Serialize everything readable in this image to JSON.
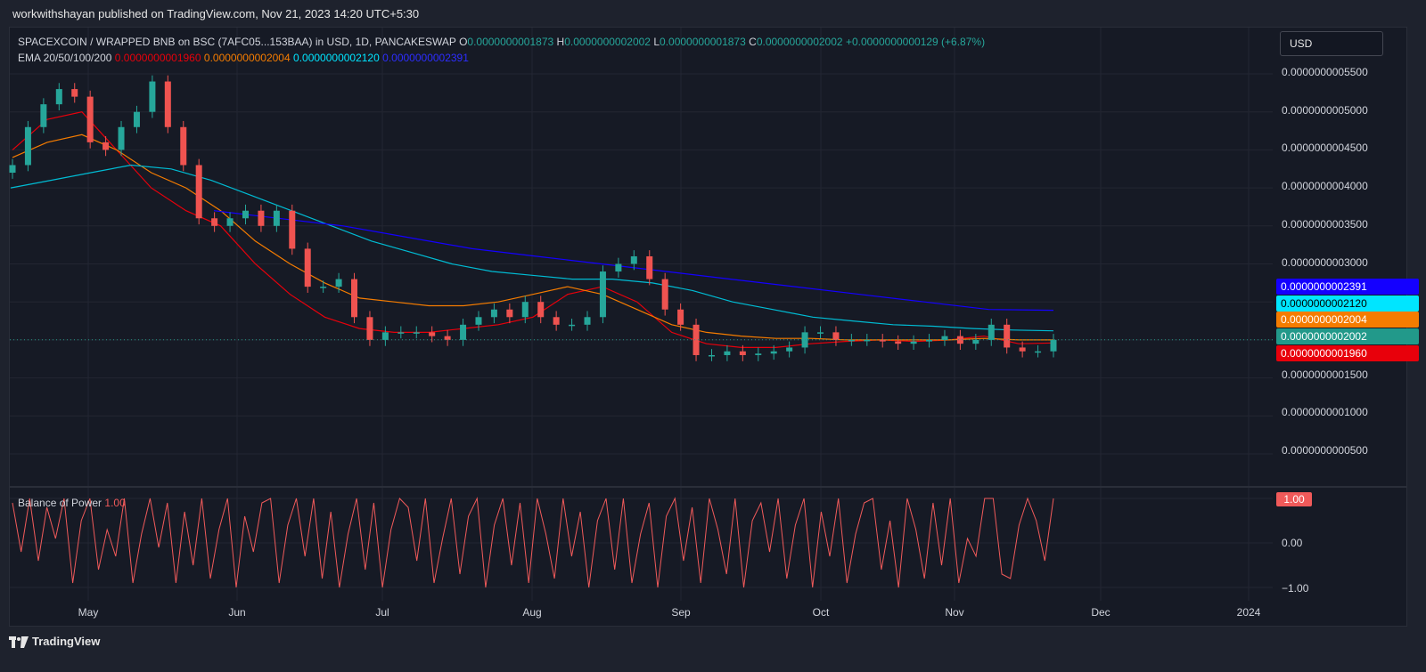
{
  "header": {
    "published": "workwithshayan published on TradingView.com, Nov 21, 2023 14:20 UTC+5:30"
  },
  "legend": {
    "symbol": "SPACEXCOIN / WRAPPED BNB on BSC (7AFC05...153BAA) in USD, 1D, PANCAKESWAP",
    "o_label": "O",
    "o": "0.0000000001873",
    "h_label": "H",
    "h": "0.0000000002002",
    "l_label": "L",
    "l": "0.0000000001873",
    "c_label": "C",
    "c": "0.0000000002002",
    "change": "+0.0000000000129 (+6.87%)",
    "ema_label": "EMA 20/50/100/200",
    "ema20": "0.0000000001960",
    "ema50": "0.0000000002004",
    "ema100": "0.0000000002120",
    "ema200": "0.0000000002391",
    "bop_label": "Balance of Power",
    "bop_value": "1.00"
  },
  "currency_button": "USD",
  "price_tags": [
    {
      "value": "0.0000000002391",
      "color": "#1400ff"
    },
    {
      "value": "0.0000000002120",
      "color": "#00e5ff"
    },
    {
      "value": "0.0000000002004",
      "color": "#f57c00"
    },
    {
      "value": "0.0000000002002",
      "color": "#22998a"
    },
    {
      "value": "0.0000000001960",
      "color": "#e8000b"
    }
  ],
  "bop_tag": "1.00",
  "footer": {
    "brand": "TradingView"
  },
  "colors": {
    "up": "#26a69a",
    "down": "#ef5350",
    "ema20": "#e8000b",
    "ema50": "#f57c00",
    "ema100": "#00bcd4",
    "ema200": "#1400ff",
    "bop": "#f05a5a"
  },
  "chart_data": [
    {
      "type": "candlestick",
      "title": "SPACEXCOIN / WRAPPED BNB on BSC (7AFC05...153BAA) in USD, 1D, PANCAKESWAP",
      "x_tick_labels": [
        "May",
        "Jun",
        "Jul",
        "Aug",
        "Sep",
        "Oct",
        "Nov",
        "Dec",
        "2024"
      ],
      "y_tick_labels": [
        "0.0000000005500",
        "0.0000000005000",
        "0.0000000004500",
        "0.0000000004000",
        "0.0000000003500",
        "0.0000000003000",
        "0.0000000001500",
        "0.0000000001000",
        "0.0000000000500"
      ],
      "ylim_e10": [
        0.2,
        5.8
      ],
      "close_e10": [
        4.3,
        4.8,
        5.1,
        5.3,
        5.2,
        4.6,
        4.5,
        4.8,
        5.0,
        5.4,
        4.8,
        4.3,
        3.6,
        3.5,
        3.6,
        3.7,
        3.5,
        3.7,
        3.2,
        2.7,
        2.7,
        2.8,
        2.3,
        2.0,
        2.1,
        2.1,
        2.1,
        2.05,
        2.0,
        2.2,
        2.3,
        2.4,
        2.3,
        2.5,
        2.3,
        2.2,
        2.2,
        2.3,
        2.9,
        3.0,
        3.1,
        2.8,
        2.4,
        2.2,
        1.8,
        1.8,
        1.85,
        1.8,
        1.82,
        1.85,
        1.9,
        2.1,
        2.1,
        2.0,
        2.0,
        2.0,
        1.98,
        1.95,
        1.98,
        2.0,
        2.05,
        1.95,
        2.0,
        2.2,
        1.9,
        1.85,
        1.85,
        2.0
      ],
      "ema_e10": {
        "EMA 20": [
          4.5,
          4.9,
          5.0,
          4.5,
          4.0,
          3.7,
          3.5,
          3.0,
          2.6,
          2.3,
          2.15,
          2.1,
          2.1,
          2.15,
          2.2,
          2.3,
          2.6,
          2.7,
          2.5,
          2.1,
          1.95,
          1.9,
          1.9,
          1.95,
          1.98,
          2.0,
          1.98,
          2.0,
          2.05,
          1.95,
          1.96
        ],
        "EMA 50": [
          4.4,
          4.6,
          4.7,
          4.5,
          4.2,
          4.0,
          3.7,
          3.3,
          3.0,
          2.75,
          2.55,
          2.5,
          2.45,
          2.45,
          2.5,
          2.6,
          2.7,
          2.6,
          2.4,
          2.2,
          2.1,
          2.05,
          2.02,
          2.02,
          2.0,
          2.0,
          2.0,
          2.0,
          2.02,
          2.0,
          2.0
        ],
        "EMA 100": [
          4.0,
          4.1,
          4.2,
          4.3,
          4.25,
          4.1,
          3.9,
          3.7,
          3.5,
          3.3,
          3.15,
          3.0,
          2.9,
          2.85,
          2.8,
          2.8,
          2.75,
          2.65,
          2.5,
          2.4,
          2.3,
          2.25,
          2.2,
          2.18,
          2.15,
          2.13,
          2.12
        ],
        "EMA 200": [
          3.7,
          3.6,
          3.5,
          3.35,
          3.2,
          3.1,
          3.0,
          2.9,
          2.8,
          2.7,
          2.6,
          2.5,
          2.4,
          2.39
        ]
      }
    },
    {
      "type": "line",
      "title": "Balance of Power",
      "ylim": [
        -1,
        1
      ],
      "y_tick_labels": [
        "1.00",
        "0.00",
        "−1.00"
      ],
      "series": [
        {
          "name": "Balance of Power",
          "values": [
            0.9,
            -0.2,
            1.0,
            -0.4,
            0.8,
            0.1,
            1.0,
            -0.9,
            0.5,
            1.0,
            -0.6,
            0.3,
            -0.3,
            1.0,
            -0.9,
            0.2,
            1.0,
            -0.1,
            0.9,
            -0.9,
            0.7,
            -0.5,
            1.0,
            -0.8,
            0.3,
            1.0,
            -1.0,
            0.6,
            -0.2,
            0.9,
            1.0,
            -0.9,
            0.4,
            1.0,
            -0.3,
            1.0,
            -0.8,
            0.7,
            -1.0,
            0.2,
            1.0,
            -0.6,
            0.9,
            -1.0,
            0.3,
            1.0,
            0.8,
            -0.4,
            1.0,
            -0.9,
            0.1,
            1.0,
            -0.7,
            0.6,
            1.0,
            -1.0,
            0.4,
            1.0,
            -0.5,
            0.9,
            -0.9,
            1.0,
            0.2,
            -0.8,
            1.0,
            -0.3,
            0.7,
            -1.0,
            0.5,
            1.0,
            -0.6,
            1.0,
            -0.9,
            0.2,
            0.9,
            -1.0,
            0.6,
            1.0,
            -0.4,
            0.8,
            -0.9,
            1.0,
            0.3,
            -0.7,
            1.0,
            -1.0,
            0.5,
            0.9,
            -0.2,
            1.0,
            -0.8,
            0.4,
            1.0,
            -1.0,
            0.7,
            -0.3,
            1.0,
            -0.9,
            0.2,
            0.9,
            1.0,
            -0.6,
            0.5,
            -1.0,
            1.0,
            0.3,
            -0.8,
            0.9,
            -0.5,
            1.0,
            -0.9,
            0.1,
            -0.3,
            1.0,
            1.0,
            -0.7,
            -0.8,
            0.4,
            1.0,
            0.5,
            -0.4,
            1.0
          ]
        }
      ]
    }
  ]
}
